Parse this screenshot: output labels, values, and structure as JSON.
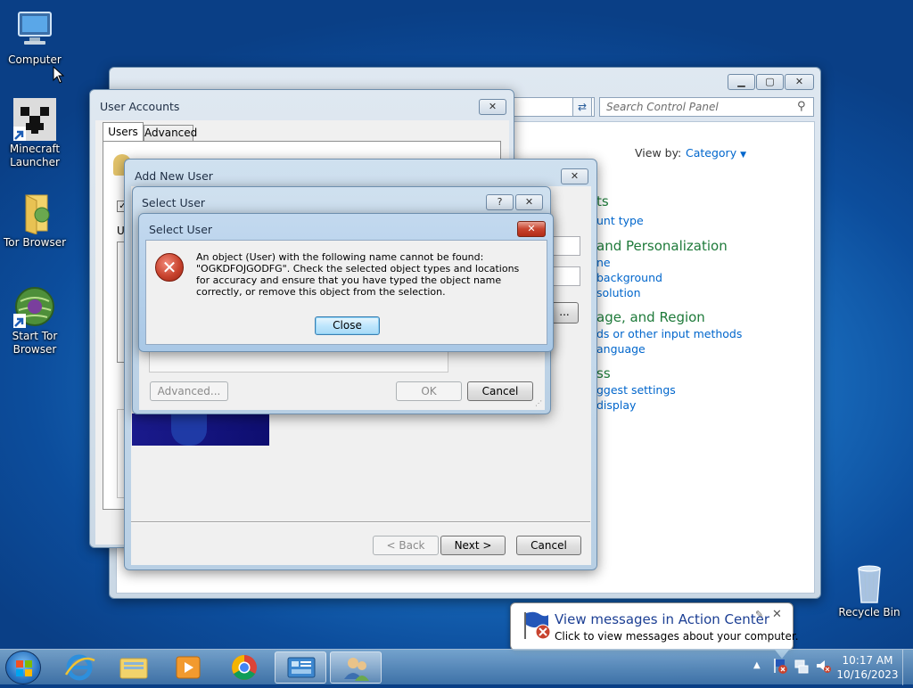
{
  "desktop": {
    "icons": [
      {
        "label": "Computer"
      },
      {
        "label": "Minecraft Launcher"
      },
      {
        "label": "Tor Browser"
      },
      {
        "label": "Start Tor Browser"
      },
      {
        "label": "Recycle Bin"
      }
    ]
  },
  "control_panel": {
    "search_placeholder": "Search Control Panel",
    "view_by_label": "View by:",
    "view_by_value": "Category",
    "sections": [
      {
        "heading": "ts",
        "links": [
          "unt type"
        ]
      },
      {
        "heading": "and Personalization",
        "links": [
          "ne",
          "background",
          "solution"
        ]
      },
      {
        "heading": "age, and Region",
        "links": [
          "ds or other input methods",
          "anguage"
        ]
      },
      {
        "heading": "ss",
        "links": [
          "ggest settings",
          "display"
        ]
      }
    ]
  },
  "user_accounts": {
    "title": "User Accounts",
    "tabs": [
      "Users",
      "Advanced"
    ],
    "partial_label": "U"
  },
  "add_new_user": {
    "title": "Add New User",
    "back_label": "< Back",
    "next_label": "Next >",
    "cancel_label": "Cancel"
  },
  "select_user": {
    "title": "Select User",
    "help_label": "?",
    "advanced_label": "Advanced...",
    "ok_label": "OK",
    "cancel_label": "Cancel"
  },
  "error_dialog": {
    "title": "Select User",
    "message": "An object (User) with the following name cannot be found: \"OGKDFOJGODFG\". Check the selected object types and locations for accuracy and ensure that you have typed the object name correctly, or remove this object from the selection.",
    "close_label": "Close"
  },
  "notification": {
    "title": "View messages in Action Center",
    "body": "Click to view messages about your computer."
  },
  "taskbar": {
    "time": "10:17 AM",
    "date": "10/16/2023"
  },
  "colors": {
    "link": "#0066cc",
    "category": "#1e7a3a",
    "error_red": "#c8432e"
  }
}
